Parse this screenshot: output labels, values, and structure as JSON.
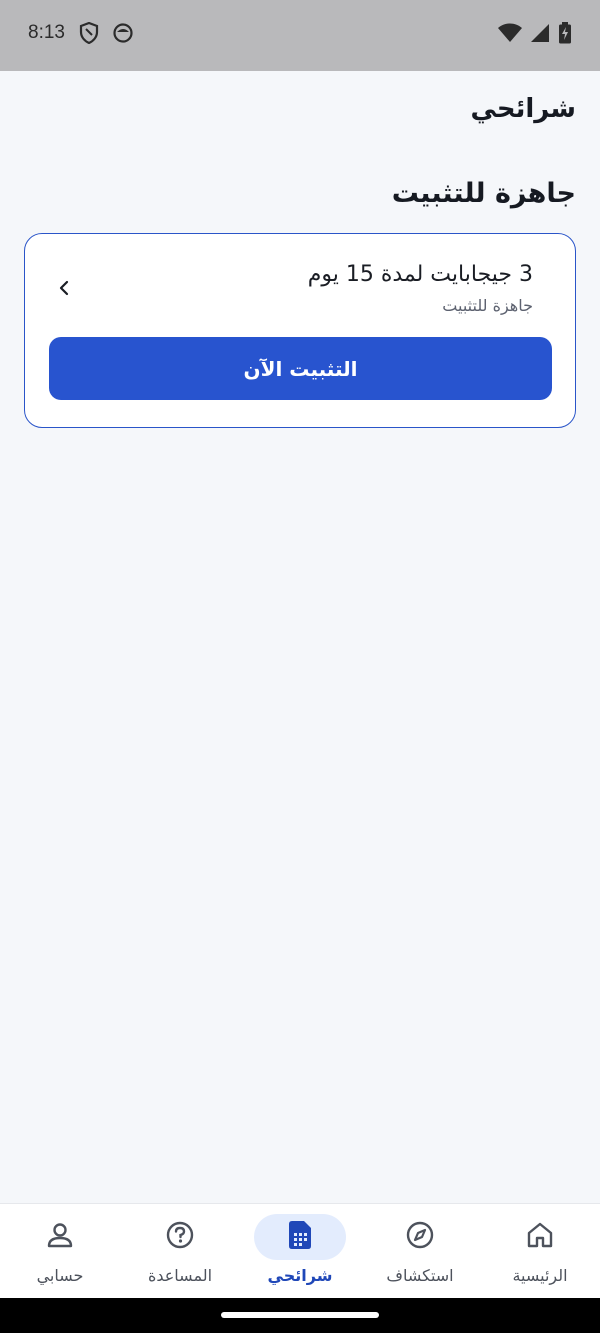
{
  "status_bar": {
    "time": "8:13",
    "icons": [
      "shield-icon",
      "face-icon",
      "wifi-icon",
      "signal-icon",
      "battery-icon"
    ]
  },
  "header": {
    "title": "شرائحي"
  },
  "section": {
    "title": "جاهزة للتثبيت"
  },
  "esim_card": {
    "name": "3 جيجابايت لمدة 15 يوم",
    "status": "جاهزة للتثبيت",
    "install_label": "التثبيت الآن",
    "accent_color": "#2854cf"
  },
  "bottom_nav": {
    "items": [
      {
        "label": "الرئيسية",
        "icon": "home-icon"
      },
      {
        "label": "استكشاف",
        "icon": "compass-icon"
      },
      {
        "label": "شرائحي",
        "icon": "sim-card-icon",
        "active": true
      },
      {
        "label": "المساعدة",
        "icon": "help-icon"
      },
      {
        "label": "حسابي",
        "icon": "user-icon"
      }
    ]
  }
}
